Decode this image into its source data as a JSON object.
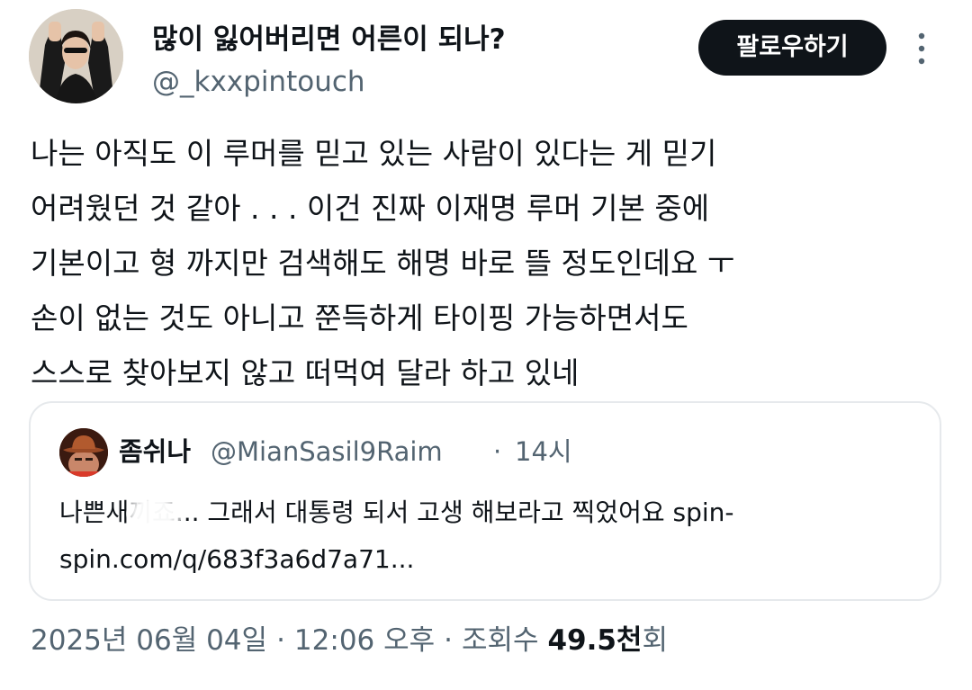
{
  "author": {
    "display_name": "많이 잃어버리면 어른이 되나?",
    "handle": "@_kxxpintouch",
    "avatar_icon": "profile-photo"
  },
  "follow_button": {
    "label": "팔로우하기"
  },
  "menu": {
    "icon": "more-vertical-icon"
  },
  "tweet": {
    "lines": [
      "나는 아직도 이 루머를 믿고 있는 사람이 있다는 게 믿기",
      "어려웠던 것 같아 . . . 이건 진짜 이재명 루머 기본 중에",
      "기본이고 형 까지만 검색해도 해명 바로 뜰 정도인데요 ㅜ",
      "손이 없는 것도 아니고 쭌득하게 타이핑 가능하면서도",
      "스스로 찾아보지 않고 떠먹여 달라 하고 있네"
    ]
  },
  "quote": {
    "name": "좀쉬나",
    "handle": "@MianSasil9Raim",
    "separator": "·",
    "time": "14시",
    "lines": [
      "나쁜새끼죠... 그래서 대통령 되서 고생 해보라고 찍었어요 spin-",
      "spin.com/q/683f3a6d7a71..."
    ]
  },
  "meta": {
    "date": "2025년 06월 04일",
    "separator": "·",
    "time": "12:06 오후",
    "views_label": "조회수",
    "views_count": "49.5천",
    "views_suffix": "회"
  },
  "colors": {
    "text": "#0f1419",
    "secondary": "#536471",
    "border": "#e6e9ec",
    "button_bg": "#0f1419",
    "button_text": "#ffffff"
  }
}
